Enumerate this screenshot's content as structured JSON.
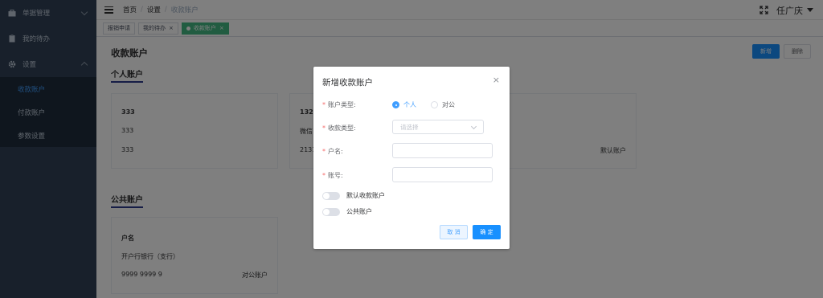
{
  "sidebar": {
    "items": [
      {
        "label": "单据管理",
        "icon": "briefcase-icon"
      },
      {
        "label": "我的待办",
        "icon": "clipboard-icon"
      },
      {
        "label": "设置",
        "icon": "gear-icon"
      }
    ],
    "sub_items": [
      {
        "label": "收款账户"
      },
      {
        "label": "付款账户"
      },
      {
        "label": "参数设置"
      }
    ]
  },
  "header": {
    "breadcrumb": [
      "首页",
      "设置",
      "收款账户"
    ],
    "separator": "/",
    "user_name": "任广庆"
  },
  "tags": [
    {
      "label": "报销申请"
    },
    {
      "label": "我的待办",
      "close": "×"
    },
    {
      "label": "收款账户",
      "close": "×"
    }
  ],
  "main": {
    "page_title": "收款账户",
    "new_button": "新增",
    "delete_button": "删除",
    "personal_section": "个人账户",
    "public_section": "公共账户",
    "personal_cards": [
      {
        "line1": "333",
        "line2": "333",
        "line3": "333",
        "badge": ""
      },
      {
        "line1": "132",
        "line2": "微信",
        "line3": "2131",
        "badge": "默认账户"
      }
    ],
    "public_cards": [
      {
        "line1": "户名",
        "line2": "开户行银行（支行）",
        "line3": "9999 9999 9",
        "badge": "对公账户"
      }
    ]
  },
  "dialog": {
    "title": "新增收款账户",
    "close": "×",
    "account_type_label": "账户类型:",
    "account_type_options": [
      "个人",
      "对公"
    ],
    "account_type_selected": "个人",
    "receive_type_label": "收款类型:",
    "receive_type_placeholder": "请选择",
    "name_label": "户名:",
    "number_label": "账号:",
    "default_switch_label": "默认收款账户",
    "public_switch_label": "公共账户",
    "cancel": "取 消",
    "confirm": "确 定",
    "required_mark": "*"
  },
  "colors": {
    "sidebar_bg": "#304156",
    "primary": "#1890ff",
    "tag_active": "#42b983"
  }
}
